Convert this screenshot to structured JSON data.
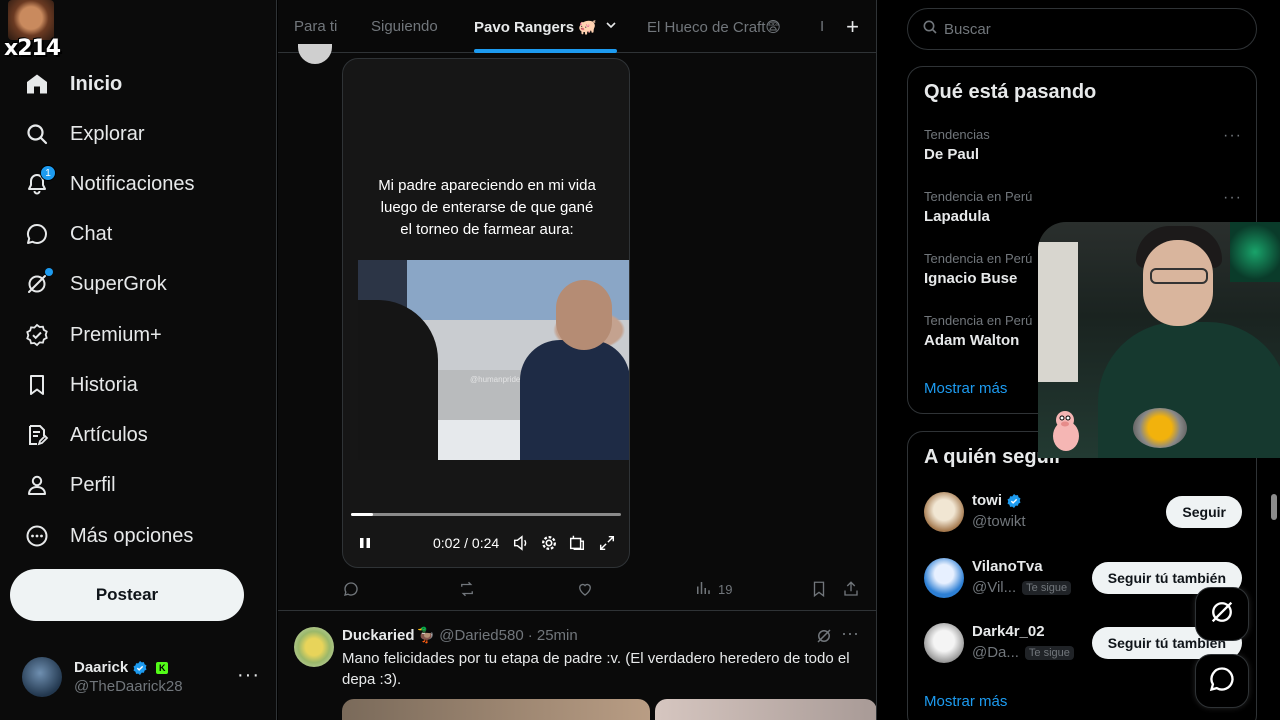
{
  "profile_tag": "x214",
  "nav": {
    "items": [
      {
        "label": "Inicio",
        "icon": "home-icon"
      },
      {
        "label": "Explorar",
        "icon": "search-icon"
      },
      {
        "label": "Notificaciones",
        "icon": "bell-icon",
        "badge": "1"
      },
      {
        "label": "Chat",
        "icon": "chat-icon"
      },
      {
        "label": "SuperGrok",
        "icon": "grok-icon"
      },
      {
        "label": "Premium+",
        "icon": "verified-badge-icon"
      },
      {
        "label": "Historia",
        "icon": "bookmark-icon"
      },
      {
        "label": "Artículos",
        "icon": "article-icon"
      },
      {
        "label": "Perfil",
        "icon": "person-icon"
      },
      {
        "label": "Más opciones",
        "icon": "more-circle-icon"
      }
    ],
    "post_button": "Postear"
  },
  "account": {
    "name": "Daarick",
    "handle": "@TheDaarick28",
    "kick_badge": "K"
  },
  "tabs": [
    {
      "label": "Para ti"
    },
    {
      "label": "Siguiendo"
    },
    {
      "label": "Pavo Rangers 🐖",
      "active": true
    },
    {
      "label": "El Hueco de Craft😨"
    },
    {
      "label": "I"
    }
  ],
  "video": {
    "caption": "Mi padre apareciendo en mi vida luego de enterarse de que gané el torneo de farmear aura:",
    "watermark": "@humanpride",
    "time": "0:02 / 0:24",
    "progress": 0.08
  },
  "post1_actions": {
    "views": "19"
  },
  "post2": {
    "name": "Duckaried",
    "emoji": "🦆",
    "handle": "@Daried580",
    "time": "· 25min",
    "text": "Mano felicidades por tu etapa de padre :v. (El verdadero heredero de todo el depa :3)."
  },
  "search": {
    "placeholder": "Buscar"
  },
  "trends": {
    "title": "Qué está pasando",
    "items": [
      {
        "context": "Tendencias",
        "title": "De Paul"
      },
      {
        "context": "Tendencia en Perú",
        "title": "Lapadula"
      },
      {
        "context": "Tendencia en Perú",
        "title": "Ignacio Buse"
      },
      {
        "context": "Tendencia en Perú",
        "title": "Adam Walton"
      }
    ],
    "show_more": "Mostrar más"
  },
  "who_to_follow": {
    "title": "A quién seguir",
    "items": [
      {
        "name": "towi",
        "handle": "@towikt",
        "follows_you": "",
        "button": "Seguir"
      },
      {
        "name": "VilanoTva",
        "handle": "@Vil...",
        "follows_you": "Te sigue",
        "button": "Seguir tú también"
      },
      {
        "name": "Dark4r_02",
        "handle": "@Da...",
        "follows_you": "Te sigue",
        "button": "Seguir tú también"
      }
    ],
    "show_more": "Mostrar más"
  },
  "colors": {
    "accent": "#1d9bf0",
    "background": "#000000",
    "text": "#e7e9ea",
    "muted": "#71767b"
  }
}
